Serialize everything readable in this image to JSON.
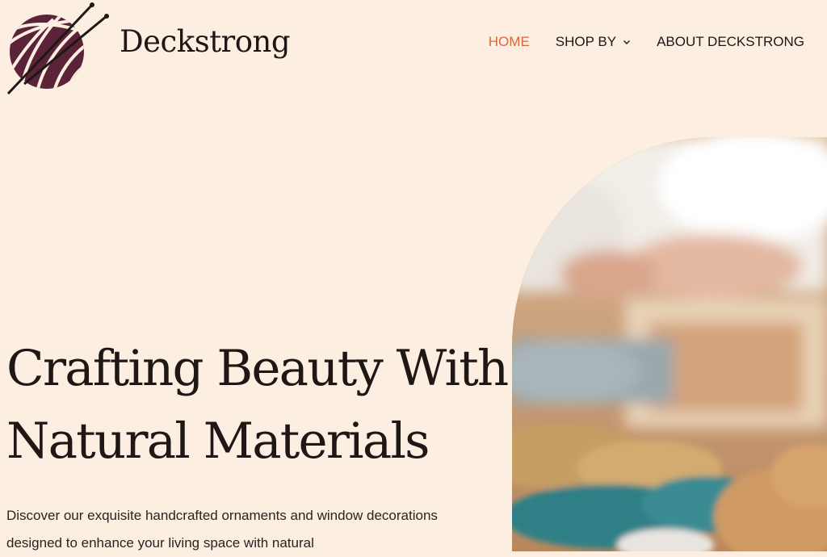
{
  "header": {
    "brand_name": "Deckstrong",
    "logo_icon": "yarn-ball-knitting-needles-icon",
    "nav": [
      {
        "label": "HOME",
        "active": true
      },
      {
        "label": "SHOP BY",
        "has_dropdown": true
      },
      {
        "label": "ABOUT DECKSTRONG"
      }
    ]
  },
  "hero": {
    "title_line1": "Crafting Beauty With",
    "title_line2": "Natural Materials",
    "description": "Discover our exquisite handcrafted ornaments and window decorations designed to enhance your living space with natural"
  },
  "colors": {
    "background": "#fdeee2",
    "accent": "#d8663c",
    "text": "#1e1716",
    "logo": "#5a2338"
  }
}
